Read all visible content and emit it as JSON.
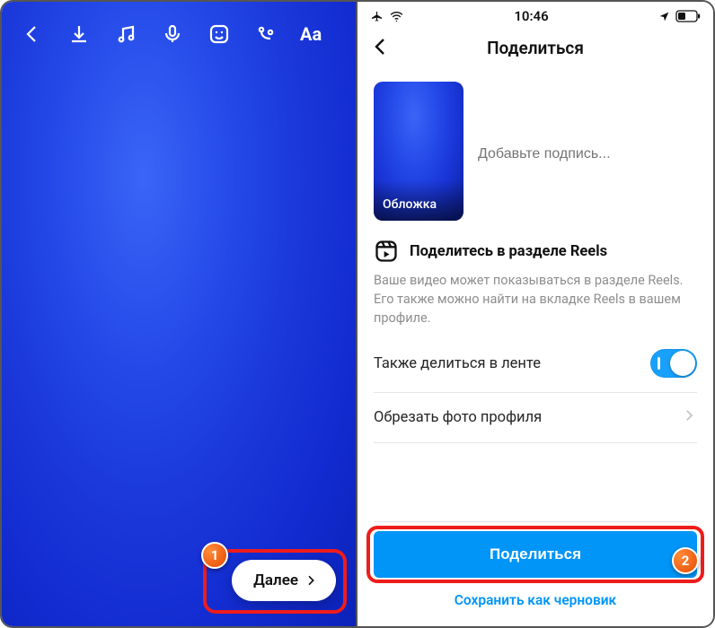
{
  "editor": {
    "next_label": "Далее"
  },
  "statusbar": {
    "time": "10:46"
  },
  "share": {
    "title": "Поделиться",
    "cover_label": "Обложка",
    "caption_placeholder": "Добавьте подпись...",
    "reels_title": "Поделитесь в разделе Reels",
    "reels_desc": "Ваше видео может показываться в разделе Reels. Его также можно найти на вкладке Reels в вашем профиле.",
    "feed_toggle_label": "Также делиться в ленте",
    "feed_toggle_on": true,
    "crop_label": "Обрезать фото профиля",
    "share_button": "Поделиться",
    "draft_link": "Сохранить как черновик"
  },
  "annotations": {
    "badge1": "1",
    "badge2": "2"
  }
}
